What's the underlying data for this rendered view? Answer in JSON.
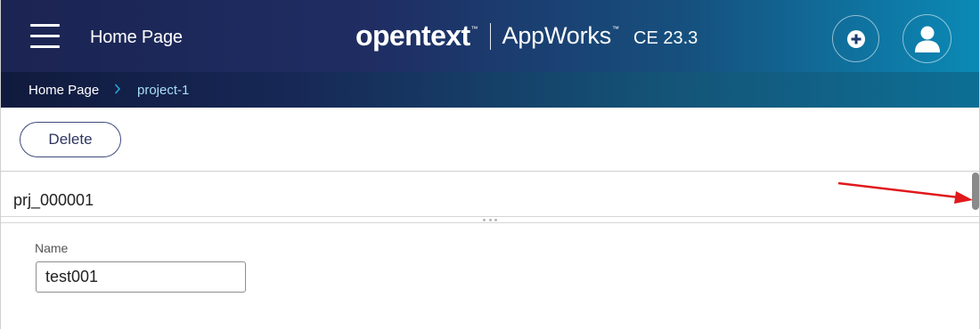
{
  "header": {
    "page_title": "Home Page",
    "brand_name": "opentext",
    "brand_tm": "™",
    "product_name": "AppWorks",
    "product_tm": "™",
    "version": "CE 23.3",
    "menu_icon": "hamburger-menu-icon",
    "add_icon": "plus-circle-icon",
    "user_icon": "user-avatar-icon",
    "background_start": "#1b2452",
    "background_end": "#0b8ab6"
  },
  "breadcrumb": {
    "items": [
      {
        "label": "Home Page"
      },
      {
        "label": "project-1"
      }
    ],
    "separator_icon": "chevron-right-icon",
    "separator_color": "#2ba4d8"
  },
  "toolbar": {
    "delete_label": "Delete"
  },
  "record": {
    "id": "prj_000001"
  },
  "form": {
    "name_label": "Name",
    "name_value": "test001"
  },
  "annotation": {
    "arrow_color": "#e0191b"
  }
}
